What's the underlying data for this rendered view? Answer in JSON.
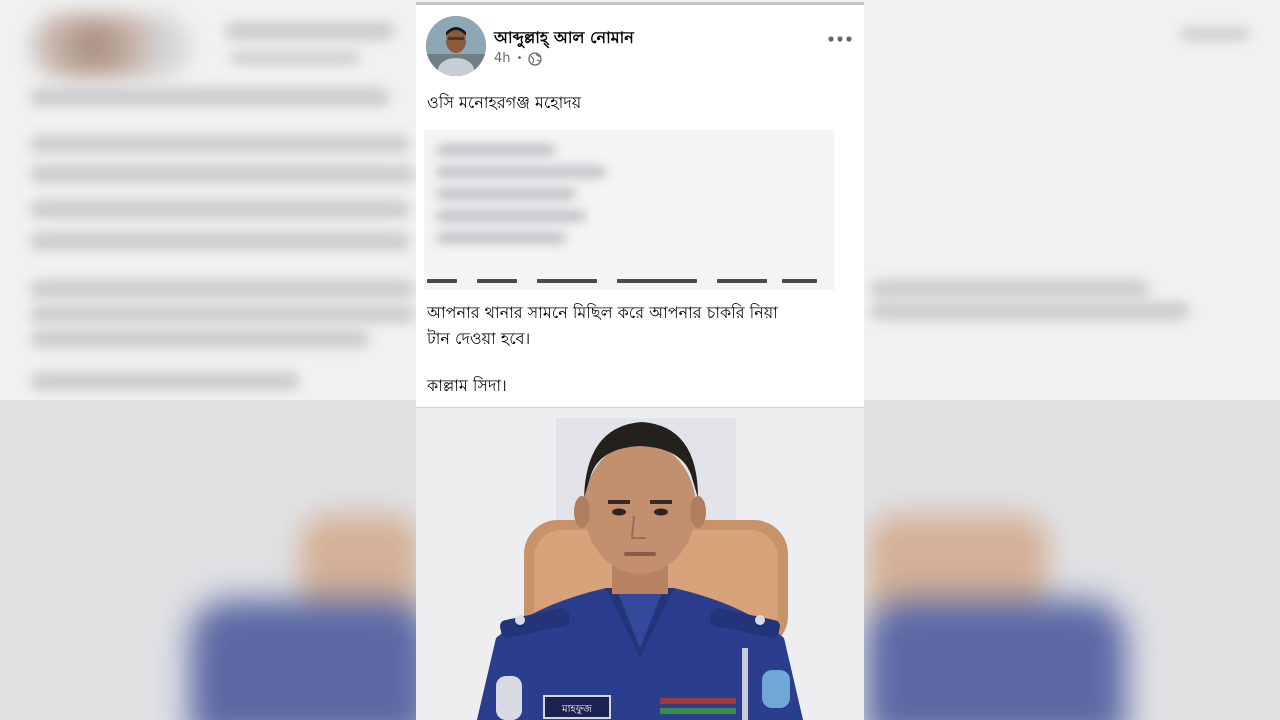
{
  "post": {
    "author_name": "আব্দুল্লাহ্ আল নোমান",
    "time_ago": "4h",
    "separator": "•",
    "greeting": "ওসি মনোহরগঞ্জ মহোদয়",
    "body_lines": [
      "আপনার থানার সামনে মিছিল করে আপনার চাকরি নিয়া",
      "টান দেওয়া হবে।"
    ],
    "closing": "কাল্লাম সিদা।",
    "photo": {
      "name_tag": "মাহফুজ"
    }
  },
  "icons": {
    "audience": "globe-icon",
    "options": "more-options-icon"
  },
  "colors": {
    "card_bg": "#ffffff",
    "text_primary": "#050505",
    "text_secondary": "#65676b",
    "uniform_blue": "#2b3d8d",
    "chair_brown": "#c9936a"
  }
}
